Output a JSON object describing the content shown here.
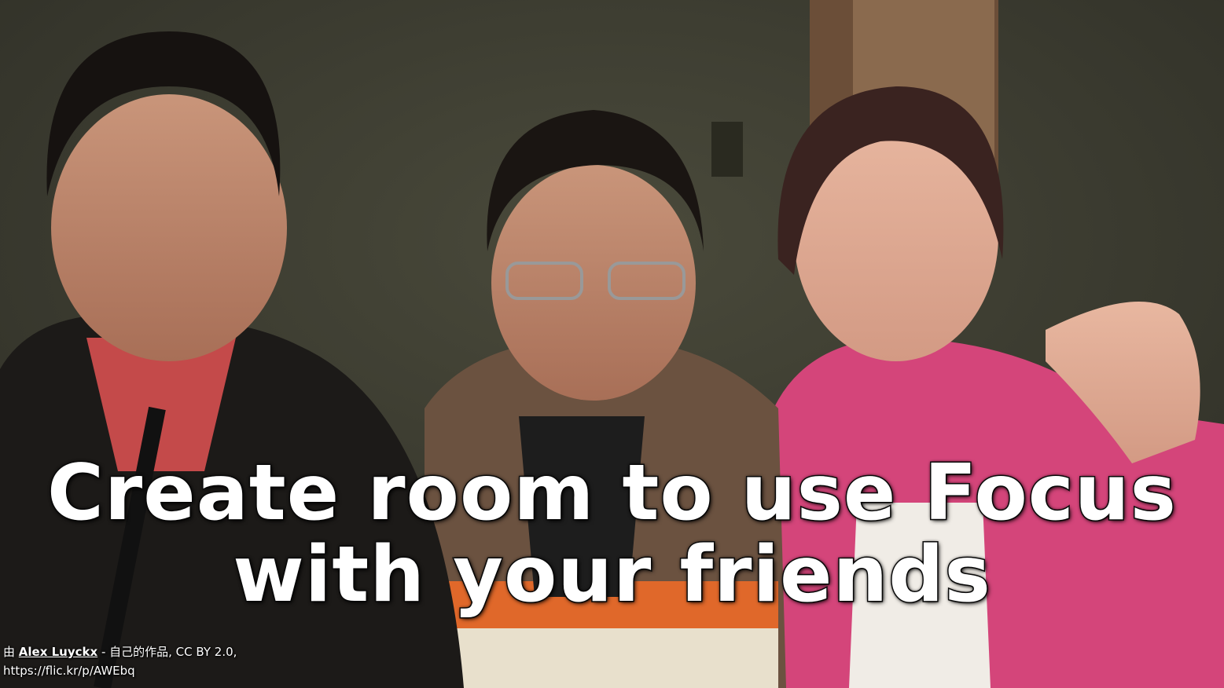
{
  "caption": {
    "line1": "Create room to use Focus",
    "line2": "with your friends"
  },
  "credit": {
    "prefix": "由 ",
    "author": "Alex Luyckx",
    "rest": " - 自己的作品, CC BY 2.0,",
    "url": "https://flic.kr/p/AWEbq"
  },
  "colors": {
    "background_wall": "#3b3b30",
    "caption_text": "#ffffff",
    "caption_outline": "#111111"
  }
}
